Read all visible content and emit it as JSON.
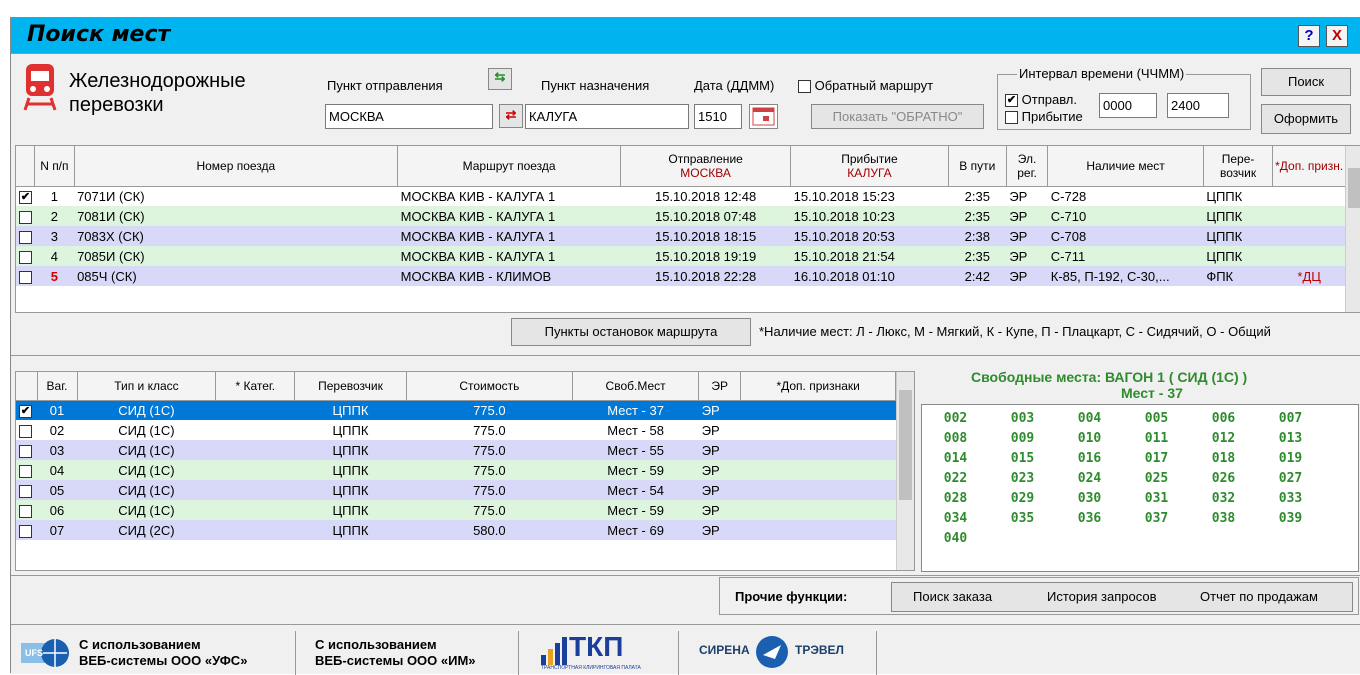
{
  "window": {
    "title": "Поиск мест",
    "help_label": "?",
    "close_label": "X"
  },
  "brand": {
    "line1": "Железнодорожные",
    "line2": "перевозки"
  },
  "search": {
    "from_label": "Пункт отправления",
    "to_label": "Пункт назначения",
    "date_label": "Дата (ДДММ)",
    "from_value": "МОСКВА",
    "to_value": "КАЛУГА",
    "date_value": "1510",
    "return_label": "Обратный маршрут",
    "show_return_label": "Показать \"ОБРАТНО\"",
    "interval_label": "Интервал времени (ЧЧММ)",
    "depart_label": "Отправл.",
    "arrive_label": "Прибытие",
    "time_from": "0000",
    "time_to": "2400",
    "search_label": "Поиск",
    "issue_label": "Оформить"
  },
  "trains": {
    "headers": [
      "N п/п",
      "Номер поезда",
      "Маршрут поезда",
      "Отправление",
      "МОСКВА",
      "Прибытие",
      "КАЛУГА",
      "В пути",
      "Эл. рег.",
      "Наличие мест",
      "Пере- возчик",
      "*Доп. призн."
    ],
    "rows": [
      {
        "check": "✔",
        "n": "1",
        "num": "7071И (СК)",
        "route": "МОСКВА КИВ - КАЛУГА 1",
        "dep": "15.10.2018  12:48",
        "arr": "15.10.2018  15:23",
        "dur": "2:35",
        "er": "ЭР",
        "seats": "С-728",
        "carrier": "ЦППК",
        "extra": ""
      },
      {
        "check": "",
        "n": "2",
        "num": "7081И (СК)",
        "route": "МОСКВА КИВ - КАЛУГА 1",
        "dep": "15.10.2018  07:48",
        "arr": "15.10.2018  10:23",
        "dur": "2:35",
        "er": "ЭР",
        "seats": "С-710",
        "carrier": "ЦППК",
        "extra": ""
      },
      {
        "check": "",
        "n": "3",
        "num": "7083Х (СК)",
        "route": "МОСКВА КИВ - КАЛУГА 1",
        "dep": "15.10.2018  18:15",
        "arr": "15.10.2018  20:53",
        "dur": "2:38",
        "er": "ЭР",
        "seats": "С-708",
        "carrier": "ЦППК",
        "extra": ""
      },
      {
        "check": "",
        "n": "4",
        "num": "7085И (СК)",
        "route": "МОСКВА КИВ - КАЛУГА 1",
        "dep": "15.10.2018  19:19",
        "arr": "15.10.2018  21:54",
        "dur": "2:35",
        "er": "ЭР",
        "seats": "С-711",
        "carrier": "ЦППК",
        "extra": ""
      },
      {
        "check": "",
        "n": "5",
        "num": "085Ч (СК)",
        "route": "МОСКВА КИВ - КЛИМОВ",
        "dep": "15.10.2018  22:28",
        "arr": "16.10.2018  01:10",
        "dur": "2:42",
        "er": "ЭР",
        "seats": "К-85, П-192, С-30,...",
        "carrier": "ФПК",
        "extra": "*ДЦ"
      }
    ]
  },
  "stops_label": "Пункты остановок маршрута",
  "legend": "*Наличие мест:  Л - Люкс, М - Мягкий, К - Купе, П - Плацкарт,  С - Сидячий, О - Общий",
  "cars": {
    "headers": [
      "Ваг.",
      "Тип и класс",
      "* Катег.",
      "Перевозчик",
      "Стоимость",
      "Своб.Мест",
      "ЭР",
      "*Доп. признаки"
    ],
    "rows": [
      {
        "check": "✔",
        "car": "01",
        "type": "СИД (1С)",
        "cat": "",
        "carrier": "ЦППК",
        "price": "775.0",
        "free": "Мест - 37",
        "er": "ЭР",
        "extra": ""
      },
      {
        "check": "",
        "car": "02",
        "type": "СИД (1С)",
        "cat": "",
        "carrier": "ЦППК",
        "price": "775.0",
        "free": "Мест - 58",
        "er": "ЭР",
        "extra": ""
      },
      {
        "check": "",
        "car": "03",
        "type": "СИД (1С)",
        "cat": "",
        "carrier": "ЦППК",
        "price": "775.0",
        "free": "Мест - 55",
        "er": "ЭР",
        "extra": ""
      },
      {
        "check": "",
        "car": "04",
        "type": "СИД (1С)",
        "cat": "",
        "carrier": "ЦППК",
        "price": "775.0",
        "free": "Мест - 59",
        "er": "ЭР",
        "extra": ""
      },
      {
        "check": "",
        "car": "05",
        "type": "СИД (1С)",
        "cat": "",
        "carrier": "ЦППК",
        "price": "775.0",
        "free": "Мест - 54",
        "er": "ЭР",
        "extra": ""
      },
      {
        "check": "",
        "car": "06",
        "type": "СИД (1С)",
        "cat": "",
        "carrier": "ЦППК",
        "price": "775.0",
        "free": "Мест - 59",
        "er": "ЭР",
        "extra": ""
      },
      {
        "check": "",
        "car": "07",
        "type": "СИД (2С)",
        "cat": "",
        "carrier": "ЦППК",
        "price": "580.0",
        "free": "Мест - 69",
        "er": "ЭР",
        "extra": ""
      }
    ]
  },
  "free_seats": {
    "title1": "Свободные места: ВАГОН 1 ( СИД (1С) )",
    "title2": "Мест - 37",
    "rows": [
      [
        "002",
        "003",
        "004",
        "005",
        "006",
        "007"
      ],
      [
        "008",
        "009",
        "010",
        "011",
        "012",
        "013"
      ],
      [
        "014",
        "015",
        "016",
        "017",
        "018",
        "019"
      ],
      [
        "022",
        "023",
        "024",
        "025",
        "026",
        "027"
      ],
      [
        "028",
        "029",
        "030",
        "031",
        "032",
        "033"
      ],
      [
        "034",
        "035",
        "036",
        "037",
        "038",
        "039"
      ],
      [
        "040",
        "",
        "",
        "",
        "",
        ""
      ]
    ]
  },
  "other": {
    "label": "Прочие функции:",
    "order": "Поиск заказа",
    "history": "История запросов",
    "report": "Отчет по продажам"
  },
  "logos": {
    "ufs": "UFS",
    "ufs_text1": "С использованием",
    "ufs_text2": "ВЕБ-системы ООО «УФС»",
    "im_text1": "С использованием",
    "im_text2": "ВЕБ-системы ООО «ИМ»",
    "tkp": "ТКП",
    "tkp_sub": "ТРАНСПОРТНАЯ КЛИРИНГОВАЯ ПАЛАТА",
    "sirena1": "СИРЕНА",
    "sirena2": "ТРЭВЕЛ"
  },
  "colors": {
    "titlebar": "#00b4f0",
    "green_row": "#dcf5dc",
    "violet_row": "#d8d8f8",
    "selected": "#0078d7",
    "seat_text": "#2e8b2e",
    "dark_red": "#a00000"
  }
}
